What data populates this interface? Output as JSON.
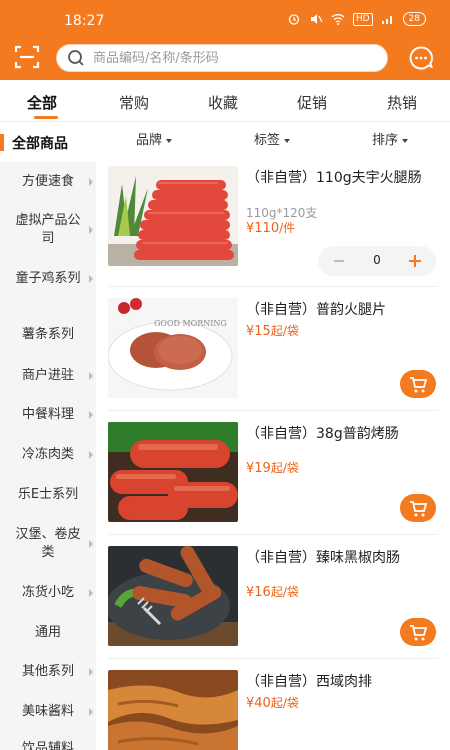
{
  "status_bar": {
    "time": "18:27",
    "hd_label": "HD",
    "battery": "28"
  },
  "search": {
    "placeholder": "商品编码/名称/条形码"
  },
  "tabs": [
    {
      "label": "全部",
      "active": true
    },
    {
      "label": "常购"
    },
    {
      "label": "收藏"
    },
    {
      "label": "促销"
    },
    {
      "label": "热销"
    }
  ],
  "sidebar": {
    "all_label": "全部商品",
    "items": [
      {
        "label": "方便速食",
        "arrow": true
      },
      {
        "label": "虚拟产品公司",
        "arrow": true
      },
      {
        "label": "童子鸡系列",
        "arrow": true
      },
      {
        "label": "薯条系列",
        "arrow": false
      },
      {
        "label": "商户进驻",
        "arrow": true
      },
      {
        "label": "中餐料理",
        "arrow": true
      },
      {
        "label": "冷冻肉类",
        "arrow": true
      },
      {
        "label": "乐E士系列",
        "arrow": false
      },
      {
        "label": "汉堡、卷皮类",
        "arrow": true
      },
      {
        "label": "冻货小吃",
        "arrow": true
      },
      {
        "label": "通用",
        "arrow": false
      },
      {
        "label": "其他系列",
        "arrow": true
      },
      {
        "label": "美味酱料",
        "arrow": true
      },
      {
        "label": "饮品辅料",
        "arrow": false
      }
    ]
  },
  "filter": {
    "brand": "品牌",
    "tag": "标签",
    "sort": "排序"
  },
  "products": [
    {
      "name": "（非自营）110g夫宇火腿肠",
      "spec": "110g*120支",
      "price": "¥110",
      "unit": "/件",
      "qty": "0"
    },
    {
      "name": "（非自营）普韵火腿片",
      "price": "¥15",
      "unit": "起/袋"
    },
    {
      "name": "（非自营）38g普韵烤肠",
      "price": "¥19",
      "unit": "起/袋"
    },
    {
      "name": "（非自营）臻味黑椒肉肠",
      "price": "¥16",
      "unit": "起/袋"
    },
    {
      "name": "（非自营）西域肉排",
      "price": "¥40",
      "unit": "起/袋"
    }
  ],
  "colors": {
    "accent": "#f47a20",
    "price": "#e8641a"
  },
  "icons": [
    "scan-icon",
    "search-icon",
    "chat-icon",
    "cart-icon",
    "plus-icon",
    "minus-icon"
  ]
}
